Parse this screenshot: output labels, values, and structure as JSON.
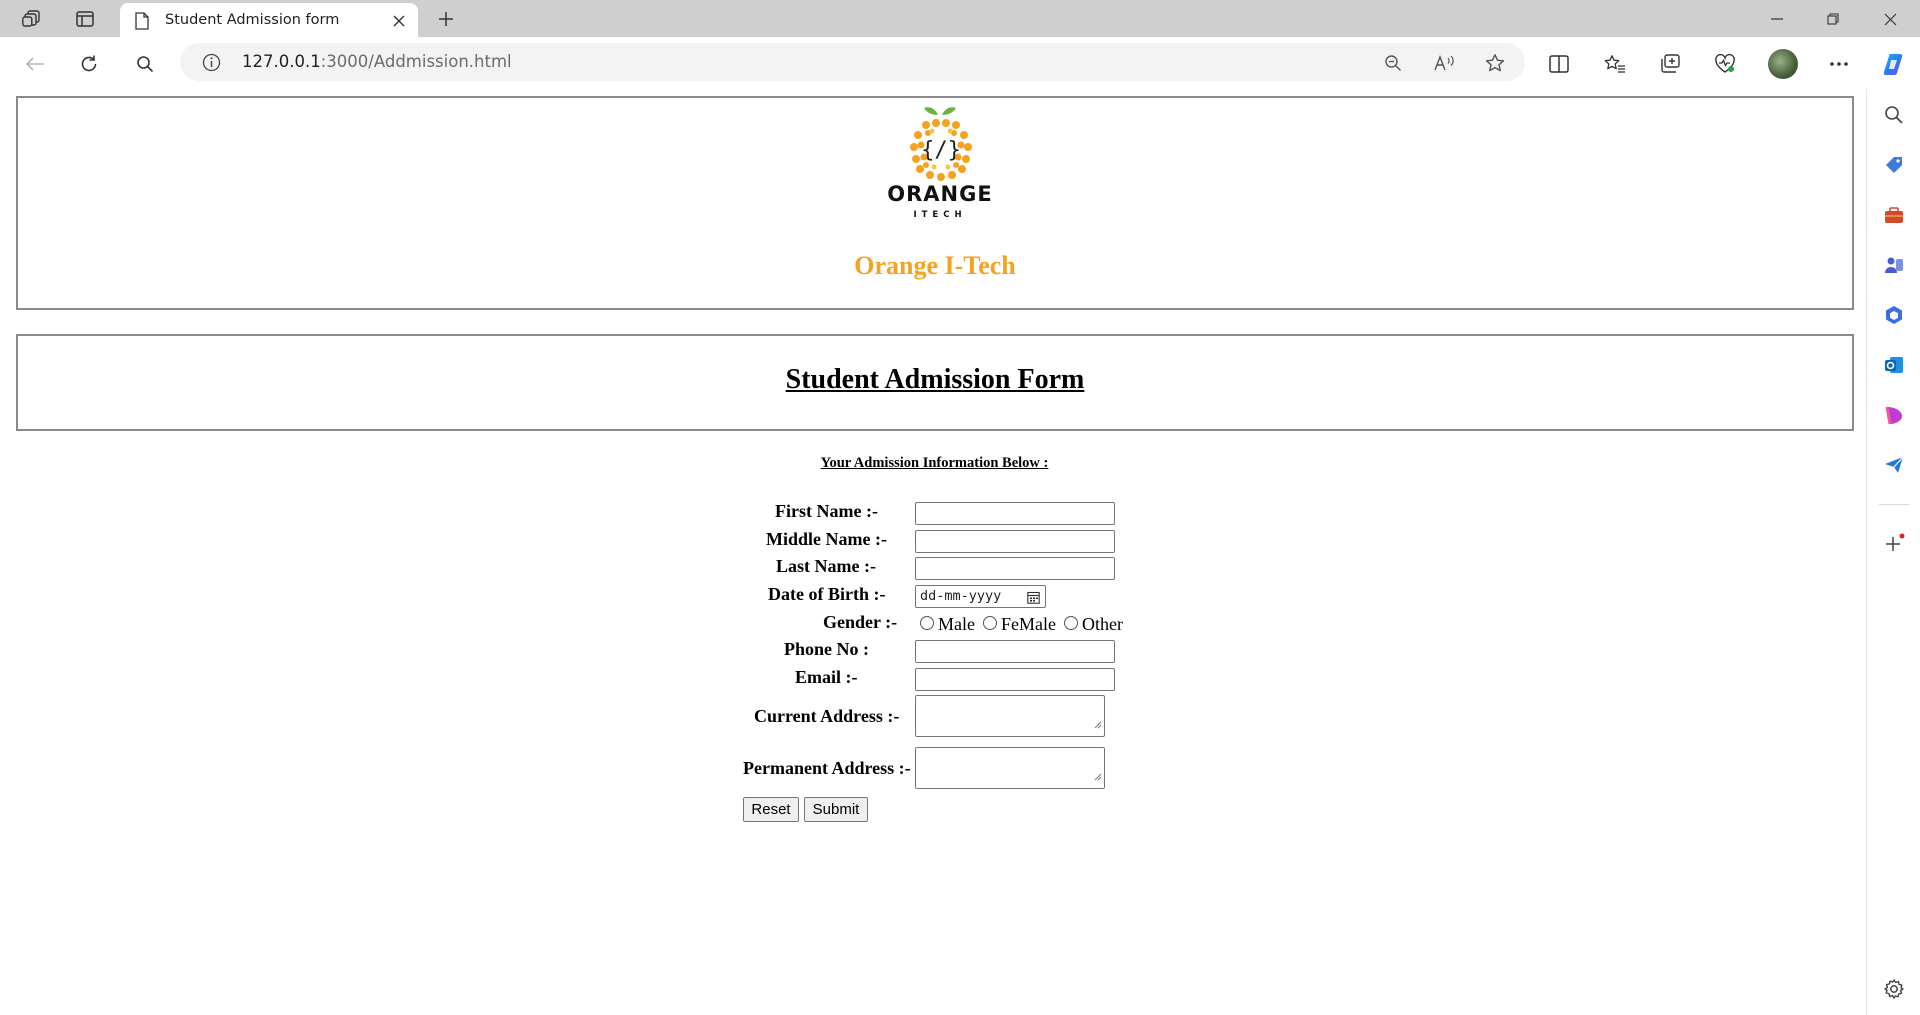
{
  "browser": {
    "tab_title": "Student Admission form",
    "url_host": "127.0.0.1",
    "url_path": ":3000/Addmission.html"
  },
  "page": {
    "brand_logo_text": "ORANGE",
    "brand_logo_sub": "ITECH",
    "brand_name": "Orange I-Tech",
    "form_title": "Student Admission Form",
    "subtitle": "Your Admission Information Below :",
    "fields": {
      "first_name": {
        "label": "First Name :-",
        "value": ""
      },
      "middle_name": {
        "label": "Middle Name :-",
        "value": ""
      },
      "last_name": {
        "label": "Last Name :-",
        "value": ""
      },
      "dob": {
        "label": "Date of Birth :-",
        "placeholder": "dd-mm-yyyy"
      },
      "gender": {
        "label": "Gender :-",
        "options": [
          "Male",
          "FeMale",
          "Other"
        ]
      },
      "phone": {
        "label": "Phone No :",
        "value": ""
      },
      "email": {
        "label": "Email :-",
        "value": ""
      },
      "current_address": {
        "label": "Current Address :-",
        "value": ""
      },
      "permanent_address": {
        "label": "Permanent Address :-",
        "value": ""
      }
    },
    "buttons": {
      "reset": "Reset",
      "submit": "Submit"
    }
  },
  "colors": {
    "brand_orange": "#f4a21f",
    "leaf_green": "#6db33f"
  }
}
